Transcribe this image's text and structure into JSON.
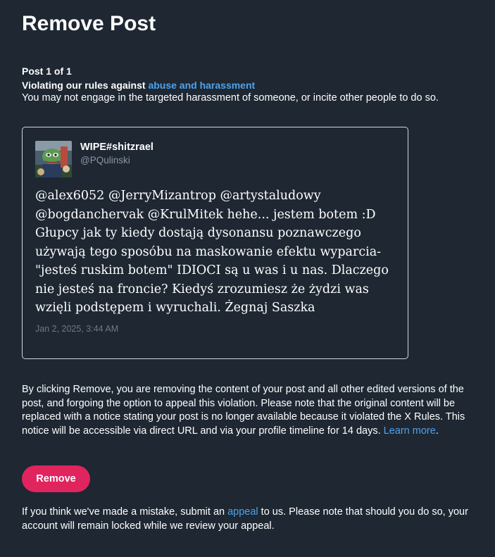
{
  "page": {
    "title": "Remove Post"
  },
  "violation": {
    "post_count": "Post 1 of 1",
    "prefix": "Violating our rules against ",
    "rule_link": "abuse and harassment",
    "description": "You may not engage in the targeted harassment of someone, or incite other people to do so."
  },
  "post": {
    "display_name": "WIPE#shitzrael",
    "handle": "@PQulinski",
    "text": "@alex6052 @JerryMizantrop @artystaludowy @bogdanchervak @KrulMitek hehe... jestem botem :D Głupcy jak ty kiedy dostają dysonansu poznawczego używają tego sposóbu na maskowanie efektu wyparcia- \"jesteś ruskim botem\" IDIOCI są u was i u nas. Dlaczego nie jesteś na froncie? Kiedyś zrozumiesz że żydzi was wzięli podstępem i wyruchali. Żegnaj Saszka",
    "timestamp": "Jan 2, 2025, 3:44 AM",
    "avatar_icon": "profile-avatar-image"
  },
  "notice": {
    "text": "By clicking Remove, you are removing the content of your post and all other edited versions of the post, and forgoing the option to appeal this violation. Please note that the original content will be replaced with a notice stating your post is no longer available because it violated the X Rules. This notice will be accessible via direct URL and via your profile timeline for 14 days. ",
    "learn_more": "Learn more",
    "suffix": "."
  },
  "actions": {
    "remove_label": "Remove"
  },
  "appeal": {
    "prefix": "If you think we've made a mistake, submit an ",
    "link": "appeal",
    "suffix": " to us. Please note that should you do so, your account will remain locked while we review your appeal."
  },
  "colors": {
    "background": "#1e2732",
    "link": "#4ea3ec",
    "remove_button": "#e0245e",
    "card_border": "#cfd9de",
    "muted_text": "#8b98a5"
  }
}
